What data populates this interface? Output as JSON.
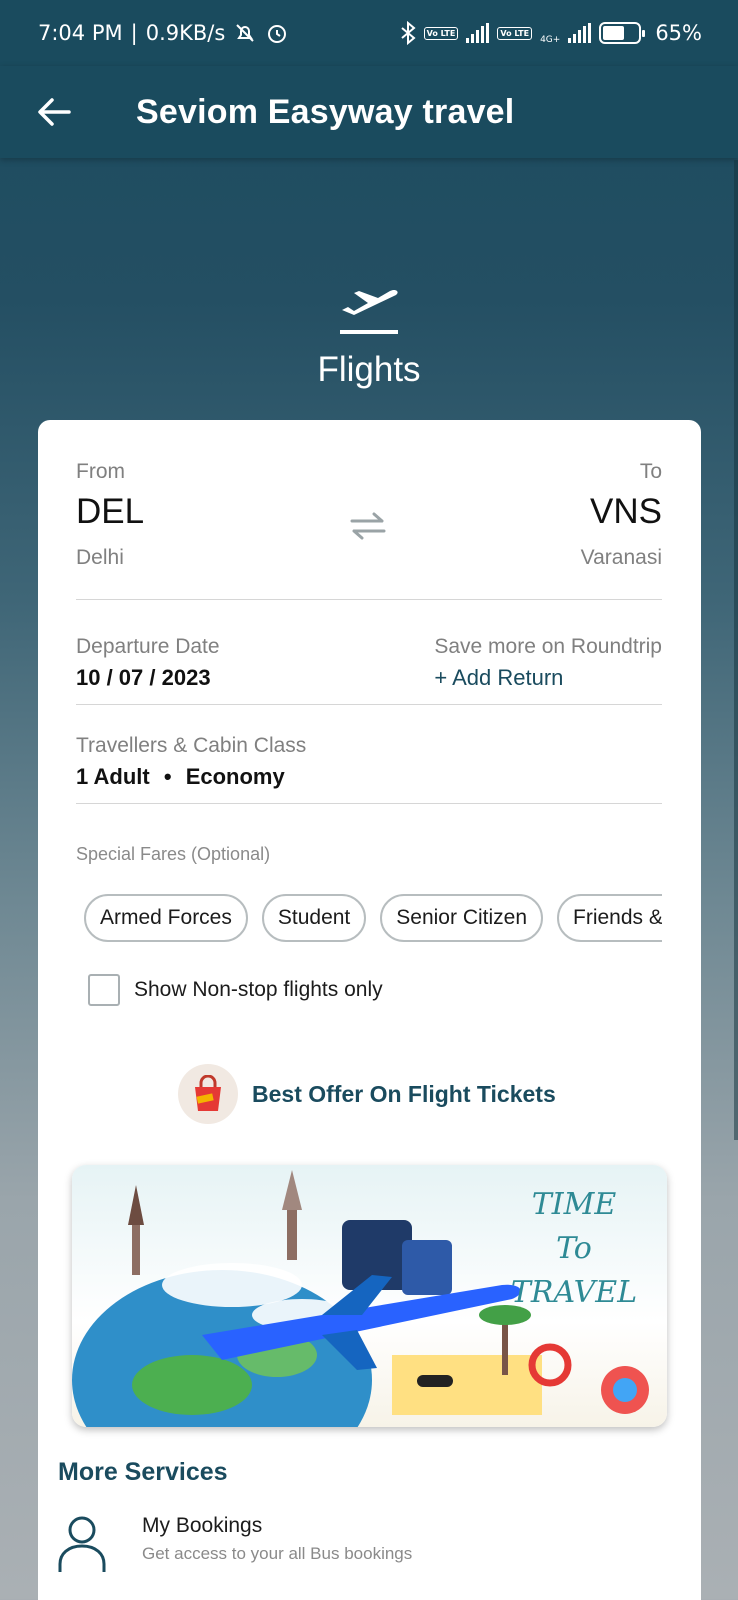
{
  "status_bar": {
    "time": "7:04 PM",
    "speed": "0.9KB/s",
    "battery": "65%",
    "network": "4G+",
    "volte_label": "Vo LTE"
  },
  "app_bar": {
    "title": "Seviom Easyway travel"
  },
  "hero": {
    "title": "Flights"
  },
  "route": {
    "from_label": "From",
    "from_code": "DEL",
    "from_city": "Delhi",
    "to_label": "To",
    "to_code": "VNS",
    "to_city": "Varanasi"
  },
  "dates": {
    "departure_label": "Departure Date",
    "departure_value": "10 / 07 / 2023",
    "return_label": "Save more on Roundtrip",
    "return_action": "+ Add Return"
  },
  "travellers": {
    "label": "Travellers & Cabin Class",
    "adults": "1 Adult",
    "separator": "•",
    "cabin": "Economy"
  },
  "special_fares": {
    "label": "Special Fares (Optional)",
    "chips": [
      "Armed Forces",
      "Student",
      "Senior Citizen",
      "Friends & Family"
    ]
  },
  "nonstop": {
    "label": "Show Non-stop flights only",
    "checked": false
  },
  "offer": {
    "label": "Best Offer On Flight Tickets"
  },
  "banner": {
    "line1": "TIME",
    "line2": "To",
    "line3": "TRAVEL"
  },
  "more_services": {
    "title": "More Services",
    "items": [
      {
        "title": "My Bookings",
        "subtitle": "Get access to your all Bus bookings"
      }
    ]
  },
  "colors": {
    "primary": "#1a4b5e",
    "accent_text": "#1a4b5e"
  }
}
